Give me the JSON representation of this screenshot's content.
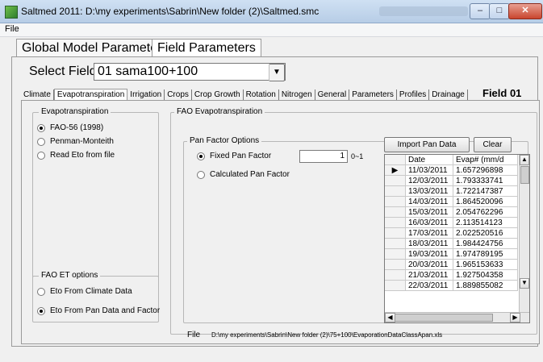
{
  "window": {
    "title": "Saltmed 2011: D:\\my experiments\\Sabrin\\New folder (2)\\Saltmed.smc",
    "min_symbol": "–",
    "max_symbol": "□",
    "close_symbol": "✕"
  },
  "menu": {
    "file": "File"
  },
  "top_tabs": [
    "Global Model Parameters",
    "Field Parameters"
  ],
  "select_field": {
    "label": "Select Field",
    "value": "01 sama100+100",
    "arrow": "▼"
  },
  "tabs": [
    "Climate",
    "Evapotranspiration",
    "Irrigation",
    "Crops",
    "Crop Growth",
    "Rotation",
    "Nitrogen",
    "General",
    "Parameters",
    "Profiles",
    "Drainage"
  ],
  "active_tab": "Evapotranspiration",
  "field_label": "Field 01",
  "evapotranspiration_group": {
    "title": "Evapotranspiration",
    "options": [
      {
        "label": "FAO-56 (1998)",
        "selected": true
      },
      {
        "label": "Penman-Monteith",
        "selected": false
      },
      {
        "label": "Read Eto from file",
        "selected": false
      }
    ]
  },
  "fao_et_options_group": {
    "title": "FAO ET options",
    "options": [
      {
        "label": "Eto From Climate Data",
        "selected": false
      },
      {
        "label": "Eto From Pan Data and Factor",
        "selected": true
      }
    ]
  },
  "fao_evap_group": {
    "title": "FAO Evapotranspiration"
  },
  "pan_factor_group": {
    "title": "Pan Factor Options",
    "fixed_label": "Fixed Pan Factor",
    "fixed_value": "1",
    "range": "0~1",
    "calculated_label": "Calculated Pan Factor"
  },
  "buttons": {
    "import": "Import Pan Data",
    "clear": "Clear"
  },
  "table": {
    "headers": [
      "Date",
      "Evap# (mm/d"
    ],
    "current_row_marker": "▶",
    "rows": [
      [
        "11/03/2011",
        "1.657296898"
      ],
      [
        "12/03/2011",
        "1.793333741"
      ],
      [
        "13/03/2011",
        "1.722147387"
      ],
      [
        "14/03/2011",
        "1.864520096"
      ],
      [
        "15/03/2011",
        "2.054762296"
      ],
      [
        "16/03/2011",
        "2.113514123"
      ],
      [
        "17/03/2011",
        "2.022520516"
      ],
      [
        "18/03/2011",
        "1.984424756"
      ],
      [
        "19/03/2011",
        "1.974789195"
      ],
      [
        "20/03/2011",
        "1.965153633"
      ],
      [
        "21/03/2011",
        "1.927504358"
      ],
      [
        "22/03/2011",
        "1.889855082"
      ]
    ]
  },
  "scroll": {
    "up": "▲",
    "down": "▼",
    "left": "◀",
    "right": "▶"
  },
  "file": {
    "label": "File",
    "path": "D:\\my experiments\\Sabrin\\New folder (2)\\75+100\\EvaporationDataClassApan.xls"
  }
}
